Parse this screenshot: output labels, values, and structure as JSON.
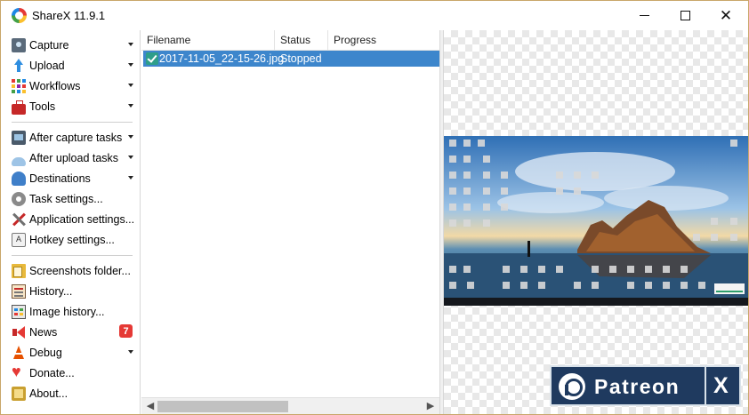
{
  "window": {
    "title": "ShareX 11.9.1"
  },
  "sidebar": {
    "items": [
      {
        "label": "Capture",
        "icon": "camera-icon",
        "has_submenu": true
      },
      {
        "label": "Upload",
        "icon": "upload-arrow-icon",
        "has_submenu": true
      },
      {
        "label": "Workflows",
        "icon": "workflows-grid-icon",
        "has_submenu": true
      },
      {
        "label": "Tools",
        "icon": "toolbox-icon",
        "has_submenu": true
      },
      {
        "label": "After capture tasks",
        "icon": "after-capture-icon",
        "has_submenu": true
      },
      {
        "label": "After upload tasks",
        "icon": "cloud-upload-icon",
        "has_submenu": true
      },
      {
        "label": "Destinations",
        "icon": "destinations-icon",
        "has_submenu": true
      },
      {
        "label": "Task settings...",
        "icon": "gear-icon",
        "has_submenu": false
      },
      {
        "label": "Application settings...",
        "icon": "wrench-screwdriver-icon",
        "has_submenu": false
      },
      {
        "label": "Hotkey settings...",
        "icon": "keyboard-key-icon",
        "has_submenu": false
      },
      {
        "label": "Screenshots folder...",
        "icon": "folder-icon",
        "has_submenu": false
      },
      {
        "label": "History...",
        "icon": "history-list-icon",
        "has_submenu": false
      },
      {
        "label": "Image history...",
        "icon": "image-history-icon",
        "has_submenu": false
      },
      {
        "label": "News",
        "icon": "megaphone-icon",
        "has_submenu": false,
        "badge": "7"
      },
      {
        "label": "Debug",
        "icon": "warning-cone-icon",
        "has_submenu": true
      },
      {
        "label": "Donate...",
        "icon": "heart-icon",
        "has_submenu": false
      },
      {
        "label": "About...",
        "icon": "info-box-icon",
        "has_submenu": false
      }
    ]
  },
  "filelist": {
    "columns": [
      "Filename",
      "Status",
      "Progress"
    ],
    "rows": [
      {
        "filename": "2017-11-05_22-15-26.jpg",
        "status": "Stopped",
        "progress": "",
        "selected": true
      }
    ]
  },
  "preview": {
    "banner": {
      "text": "Patreon",
      "close": "X"
    }
  },
  "colors": {
    "selection": "#3d86cc",
    "patreon_bg": "#1f3a5f",
    "badge": "#e53935"
  }
}
